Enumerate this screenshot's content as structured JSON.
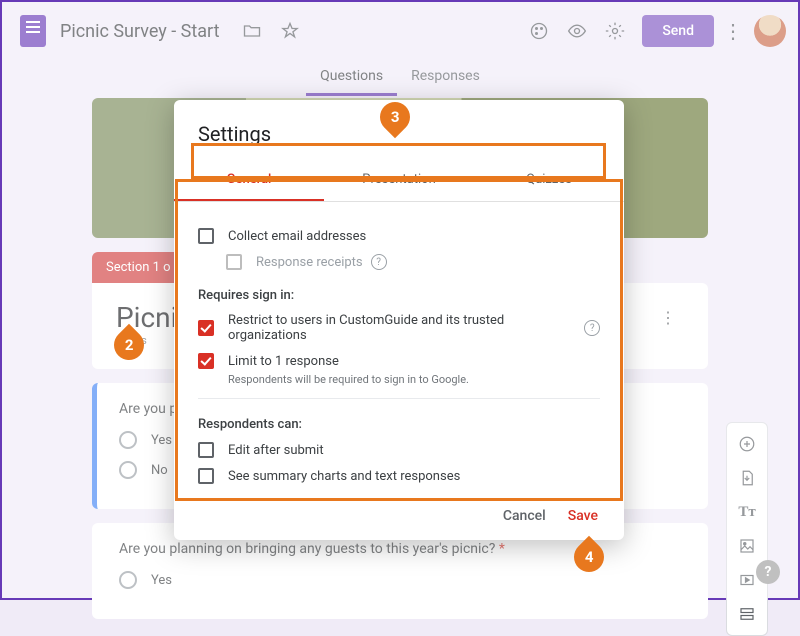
{
  "header": {
    "doc_title": "Picnic Survey - Start",
    "send_label": "Send"
  },
  "main_tabs": {
    "questions": "Questions",
    "responses": "Responses"
  },
  "bg": {
    "section_banner": "Section 1 o",
    "form_title": "Picni",
    "form_sub": "s a s",
    "q1": {
      "text": "Are you p",
      "opt_yes": "Yes",
      "opt_no": "No"
    },
    "q2": {
      "text": "Are you planning on bringing any guests to this year's picnic?",
      "opt_yes": "Yes"
    }
  },
  "modal": {
    "title": "Settings",
    "tabs": {
      "general": "General",
      "presentation": "Presentation",
      "quizzes": "Quizzes"
    },
    "collect_email": "Collect email addresses",
    "response_receipts": "Response receipts",
    "requires_signin": "Requires sign in:",
    "restrict_org": "Restrict to users in CustomGuide and its trusted organizations",
    "limit_one": "Limit to 1 response",
    "limit_one_hint": "Respondents will be required to sign in to Google.",
    "respondents_can": "Respondents can:",
    "edit_after": "Edit after submit",
    "see_summary": "See summary charts and text responses",
    "cancel": "Cancel",
    "save": "Save"
  },
  "callouts": {
    "c2": "2",
    "c3": "3",
    "c4": "4"
  }
}
